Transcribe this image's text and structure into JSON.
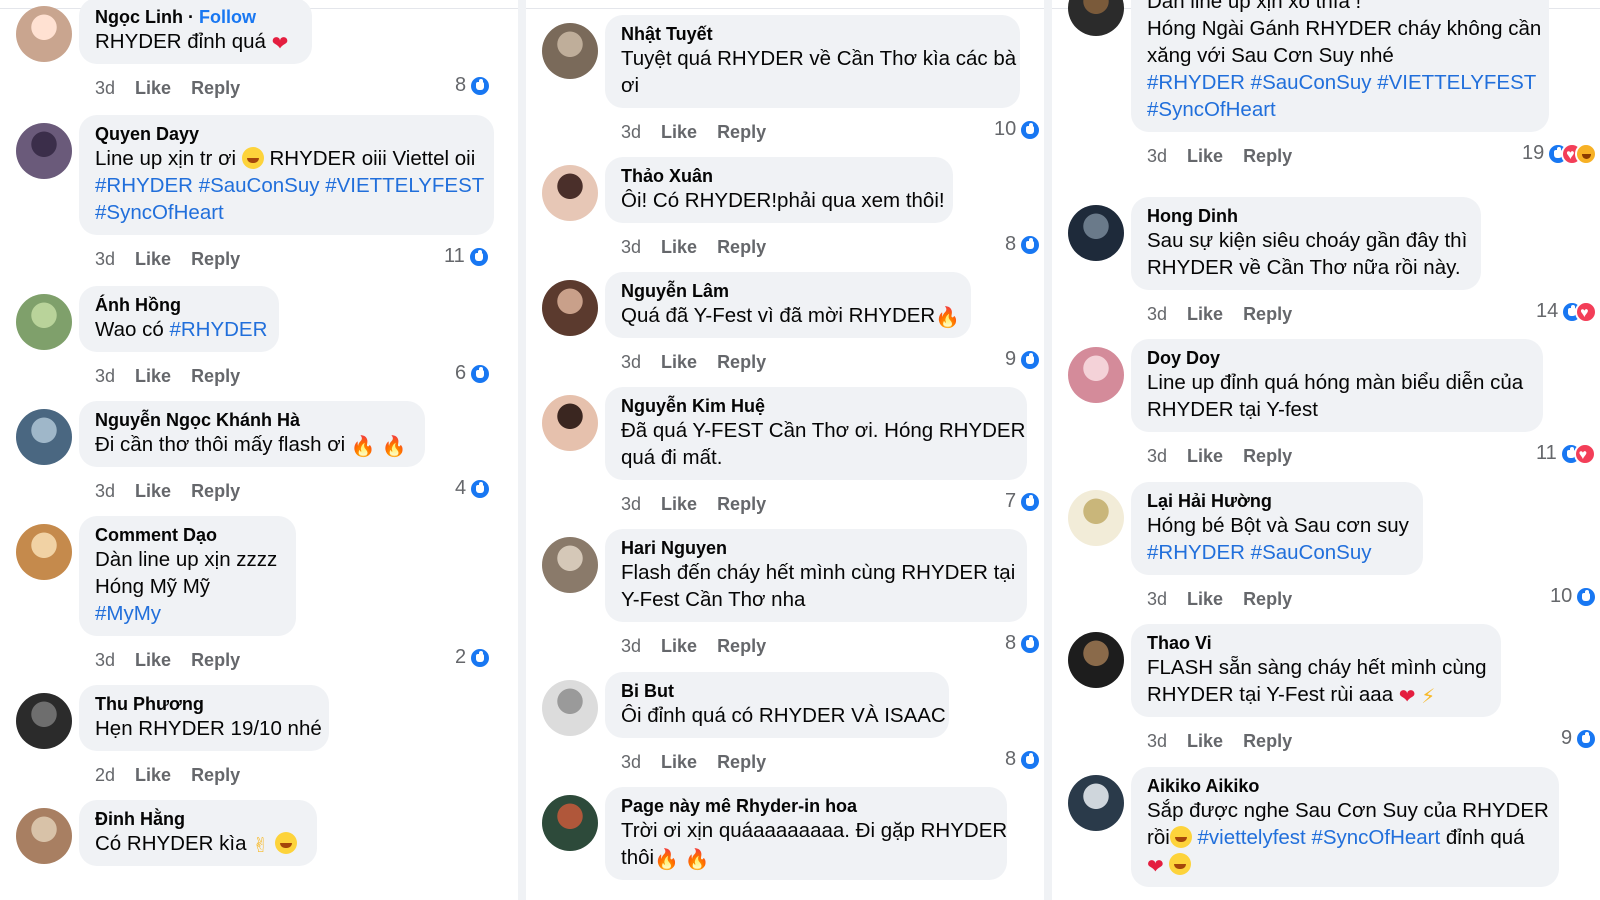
{
  "actions": {
    "like": "Like",
    "reply": "Reply"
  },
  "columns": [
    {
      "comments": [
        {
          "name": "Ngọc Linh",
          "follow_sep": " · ",
          "follow": "Follow",
          "lines": [
            [
              {
                "t": "RHYDER đỉnh quá "
              },
              {
                "e": "heart",
                "g": "❤"
              }
            ]
          ],
          "time": "3d",
          "count": "8",
          "reactions": [
            "like"
          ]
        },
        {
          "name": "Quyen Dayy",
          "lines": [
            [
              {
                "t": "Line up xịn tr ơi "
              },
              {
                "e": "face",
                "g": ""
              },
              {
                "t": " RHYDER oiii Viettel oii"
              }
            ],
            [
              {
                "h": "#RHYDER"
              },
              {
                "t": " "
              },
              {
                "h": "#SauConSuy"
              },
              {
                "t": " "
              },
              {
                "h": "#VIETTELYFEST"
              }
            ],
            [
              {
                "h": "#SyncOfHeart"
              }
            ]
          ],
          "time": "3d",
          "count": "11",
          "reactions": [
            "like"
          ]
        },
        {
          "name": "Ánh Hồng",
          "lines": [
            [
              {
                "t": "Wao có "
              },
              {
                "h": "#RHYDER"
              }
            ]
          ],
          "time": "3d",
          "count": "6",
          "reactions": [
            "like"
          ]
        },
        {
          "name": "Nguyễn Ngọc Khánh Hà",
          "lines": [
            [
              {
                "t": "Đi cần thơ thôi mấy flash ơi "
              },
              {
                "e": "fire",
                "g": "🔥"
              },
              {
                "t": " "
              },
              {
                "e": "fire",
                "g": "🔥"
              }
            ]
          ],
          "time": "3d",
          "count": "4",
          "reactions": [
            "like"
          ]
        },
        {
          "name": "Comment Dạo",
          "lines": [
            [
              {
                "t": "Dàn line up xịn zzzz"
              }
            ],
            [
              {
                "t": "Hóng Mỹ Mỹ"
              }
            ],
            [
              {
                "h": "#MyMy"
              }
            ]
          ],
          "time": "3d",
          "count": "2",
          "reactions": [
            "like"
          ]
        },
        {
          "name": "Thu Phương",
          "lines": [
            [
              {
                "t": "Hẹn RHYDER 19/10 nhé"
              }
            ]
          ],
          "time": "2d",
          "count": "",
          "reactions": []
        },
        {
          "name": "Đinh Hằng",
          "lines": [
            [
              {
                "t": "Có RHYDER kìa "
              },
              {
                "e": "bolt",
                "g": "✌"
              },
              {
                "t": " "
              },
              {
                "e": "face",
                "g": ""
              }
            ]
          ],
          "time": "",
          "count": "",
          "reactions": []
        }
      ]
    },
    {
      "comments": [
        {
          "name": "Nhật Tuyết",
          "lines": [
            [
              {
                "t": "Tuyệt quá RHYDER về Cần Thơ kìa các bà"
              }
            ],
            [
              {
                "t": "ơi"
              }
            ]
          ],
          "time": "3d",
          "count": "10",
          "reactions": [
            "like"
          ]
        },
        {
          "name": "Thảo Xuân",
          "lines": [
            [
              {
                "t": "Ôi! Có RHYDER!phải qua xem thôi!"
              }
            ]
          ],
          "time": "3d",
          "count": "8",
          "reactions": [
            "like"
          ]
        },
        {
          "name": "Nguyễn Lâm",
          "lines": [
            [
              {
                "t": "Quá đã Y-Fest vì đã mời RHYDER"
              },
              {
                "e": "fire",
                "g": "🔥"
              }
            ]
          ],
          "time": "3d",
          "count": "9",
          "reactions": [
            "like"
          ]
        },
        {
          "name": "Nguyễn Kim Huệ",
          "lines": [
            [
              {
                "t": "Đã quá Y-FEST Cần Thơ ơi. Hóng RHYDER"
              }
            ],
            [
              {
                "t": "quá đi mất."
              }
            ]
          ],
          "time": "3d",
          "count": "7",
          "reactions": [
            "like"
          ]
        },
        {
          "name": "Hari Nguyen",
          "lines": [
            [
              {
                "t": "Flash đến cháy hết mình cùng RHYDER tại"
              }
            ],
            [
              {
                "t": "Y-Fest Cần Thơ nha"
              }
            ]
          ],
          "time": "3d",
          "count": "8",
          "reactions": [
            "like"
          ]
        },
        {
          "name": "Bi But",
          "lines": [
            [
              {
                "t": "Ôi đỉnh quá có RHYDER VÀ ISAAC"
              }
            ]
          ],
          "time": "3d",
          "count": "8",
          "reactions": [
            "like"
          ]
        },
        {
          "name": "Page này mê Rhyder-in hoa",
          "lines": [
            [
              {
                "t": "Trời ơi xịn quáaaaaaaaa. Đi gặp RHYDER"
              }
            ],
            [
              {
                "t": "thôi"
              },
              {
                "e": "fire",
                "g": "🔥"
              },
              {
                "t": " "
              },
              {
                "e": "fire",
                "g": "🔥"
              }
            ]
          ],
          "time": "",
          "count": "",
          "reactions": []
        }
      ]
    },
    {
      "comments": [
        {
          "name": "",
          "lines": [
            [
              {
                "t": "Dàn line up xịn xò thía !"
              }
            ],
            [
              {
                "t": "Hóng Ngài Gánh RHYDER cháy không cần"
              }
            ],
            [
              {
                "t": "xăng với Sau Cơn Suy nhé"
              }
            ],
            [
              {
                "h": "#RHYDER"
              },
              {
                "t": " "
              },
              {
                "h": "#SauConSuy"
              },
              {
                "t": " "
              },
              {
                "h": "#VIETTELYFEST"
              }
            ],
            [
              {
                "h": "#SyncOfHeart"
              }
            ]
          ],
          "time": "3d",
          "count": "19",
          "reactions": [
            "like",
            "love",
            "haha"
          ]
        },
        {
          "name": "Hong Dinh",
          "lines": [
            [
              {
                "t": "Sau sự kiện siêu choáy gần đây thì"
              }
            ],
            [
              {
                "t": "RHYDER về Cần Thơ nữa rồi này."
              }
            ]
          ],
          "time": "3d",
          "count": "14",
          "reactions": [
            "like",
            "love"
          ]
        },
        {
          "name": "Doy Doy",
          "lines": [
            [
              {
                "t": "Line up đỉnh quá hóng màn biểu diễn của"
              }
            ],
            [
              {
                "t": "RHYDER tại Y-fest"
              }
            ]
          ],
          "time": "3d",
          "count": "11",
          "reactions": [
            "like",
            "love"
          ]
        },
        {
          "name": "Lại Hải Hường",
          "lines": [
            [
              {
                "t": "Hóng bé Bột và Sau cơn suy"
              }
            ],
            [
              {
                "h": "#RHYDER"
              },
              {
                "t": " "
              },
              {
                "h": "#SauConSuy"
              }
            ]
          ],
          "time": "3d",
          "count": "10",
          "reactions": [
            "like"
          ]
        },
        {
          "name": "Thao Vi",
          "lines": [
            [
              {
                "t": "FLASH sẵn sàng cháy hết mình cùng"
              }
            ],
            [
              {
                "t": "RHYDER tại Y-Fest rùi aaa "
              },
              {
                "e": "heart",
                "g": "❤"
              },
              {
                "t": " "
              },
              {
                "e": "bolt",
                "g": "⚡"
              }
            ]
          ],
          "time": "3d",
          "count": "9",
          "reactions": [
            "like"
          ]
        },
        {
          "name": "Aikiko Aikiko",
          "lines": [
            [
              {
                "t": "Sắp được nghe Sau Cơn Suy của RHYDER"
              }
            ],
            [
              {
                "t": "rồi"
              },
              {
                "e": "face",
                "g": ""
              },
              {
                "t": " "
              },
              {
                "h": "#viettelyfest"
              },
              {
                "t": " "
              },
              {
                "h": "#SyncOfHeart"
              },
              {
                "t": " đỉnh quá"
              }
            ],
            [
              {
                "e": "heart",
                "g": "❤"
              },
              {
                "t": " "
              },
              {
                "e": "face",
                "g": ""
              }
            ]
          ],
          "time": "",
          "count": "",
          "reactions": []
        }
      ]
    }
  ]
}
